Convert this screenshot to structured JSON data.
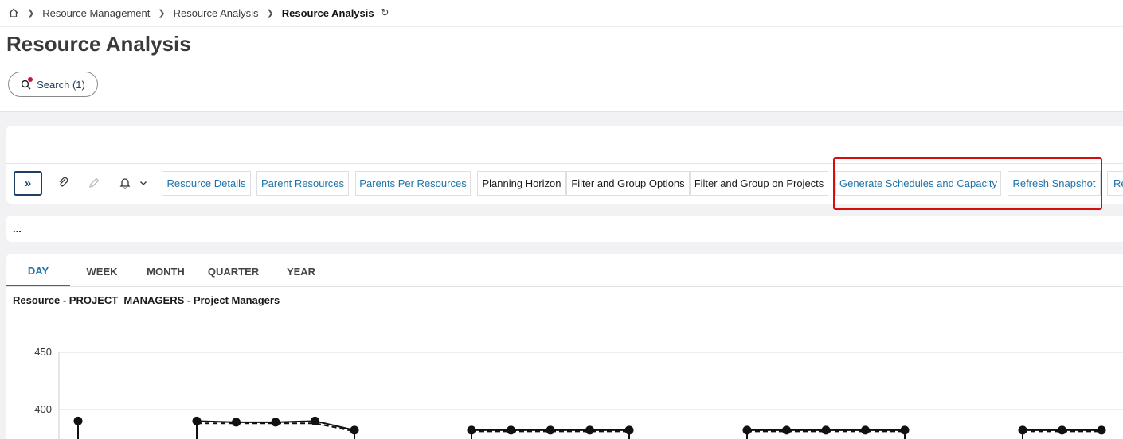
{
  "breadcrumb": {
    "items": [
      "Resource Management",
      "Resource Analysis"
    ],
    "current": "Resource Analysis"
  },
  "page": {
    "title": "Resource Analysis"
  },
  "search": {
    "label": "Search (1)"
  },
  "toolbar": {
    "buttons": [
      "Resource Details",
      "Parent Resources",
      "Parents Per Resources",
      "Planning Horizon",
      "Filter and Group Options",
      "Filter and Group on Projects",
      "Generate Schedules and Capacity",
      "Refresh Snapshot",
      "Re"
    ]
  },
  "filter_summary": "...",
  "tabs": [
    "DAY",
    "WEEK",
    "MONTH",
    "QUARTER",
    "YEAR"
  ],
  "active_tab": "DAY",
  "chart_title": "Resource - PROJECT_MANAGERS - Project Managers",
  "chart_data": {
    "type": "line",
    "title": "Resource - PROJECT_MANAGERS - Project Managers",
    "yticks": [
      450,
      400
    ],
    "ylim_visible": [
      378,
      450
    ],
    "grid": true,
    "series": [
      {
        "style": "solid",
        "segments": [
          [
            390
          ],
          [
            390,
            389,
            389,
            390,
            382
          ],
          [
            382,
            382,
            382,
            382,
            382
          ],
          [
            382,
            382,
            382,
            382,
            382
          ],
          [
            382,
            382,
            382
          ]
        ]
      },
      {
        "style": "dashed",
        "segments": [
          [
            388
          ],
          [
            388,
            388,
            388,
            388,
            381
          ],
          [
            381,
            381,
            381,
            381,
            381
          ],
          [
            381,
            381,
            381,
            381,
            381
          ],
          [
            381,
            381,
            381
          ]
        ]
      }
    ]
  },
  "colors": {
    "accent": "#1e73a8",
    "highlight": "#d60d0d",
    "dark": "#1f3f66"
  }
}
